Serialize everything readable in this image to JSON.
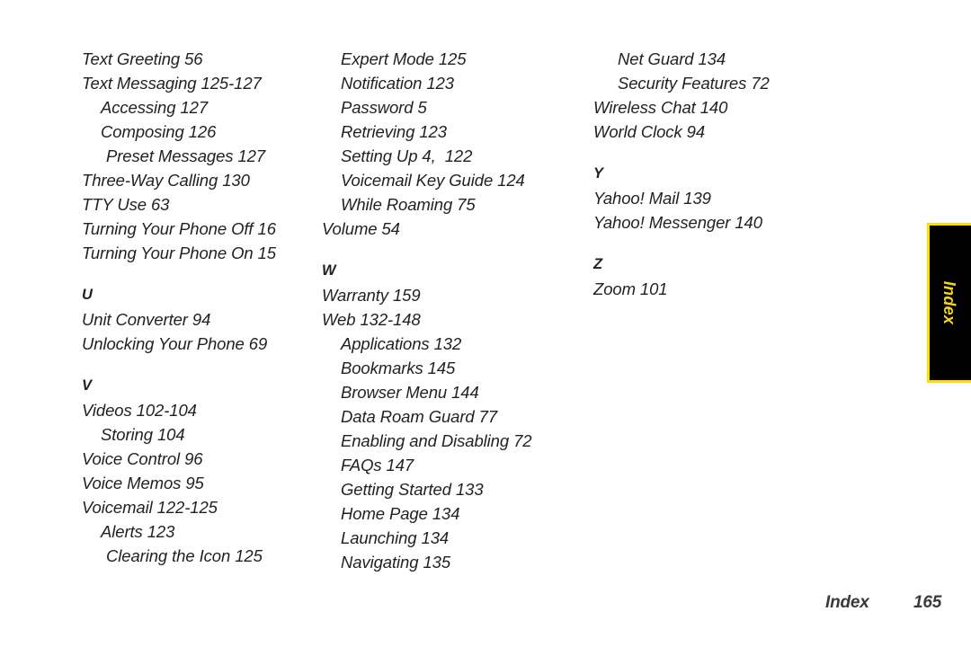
{
  "page": {
    "footer_label": "Index",
    "footer_page_number": "165",
    "thumb_tab_label": "Index",
    "colors": {
      "background": "#ffffff",
      "text": "#231f20",
      "tab_background": "#000000",
      "tab_border": "#ffdd00",
      "tab_text": "#f7d518",
      "footer_text": "#3a3a3c"
    }
  },
  "columns": [
    {
      "id": "column-1",
      "blocks": [
        {
          "type": "entries",
          "entries": [
            {
              "text": "Text Greeting 56",
              "level": 0
            },
            {
              "text": "Text Messaging 125-127",
              "level": 0
            },
            {
              "text": "Accessing 127",
              "level": 1
            },
            {
              "text": "Composing 126",
              "level": 1
            },
            {
              "text": "Preset Messages 127",
              "level": 2
            },
            {
              "text": "Three-Way Calling 130",
              "level": 0
            },
            {
              "text": "TTY Use 63",
              "level": 0
            },
            {
              "text": "Turning Your Phone Off 16",
              "level": 0
            },
            {
              "text": "Turning Your Phone On 15",
              "level": 0
            }
          ]
        },
        {
          "type": "section",
          "heading": "U",
          "entries": [
            {
              "text": "Unit Converter 94",
              "level": 0
            },
            {
              "text": "Unlocking Your Phone 69",
              "level": 0
            }
          ]
        },
        {
          "type": "section",
          "heading": "V",
          "entries": [
            {
              "text": "Videos 102-104",
              "level": 0
            },
            {
              "text": "Storing 104",
              "level": 1
            },
            {
              "text": "Voice Control 96",
              "level": 0
            },
            {
              "text": "Voice Memos 95",
              "level": 0
            },
            {
              "text": "Voicemail 122-125",
              "level": 0
            },
            {
              "text": "Alerts 123",
              "level": 1
            },
            {
              "text": "Clearing the Icon 125",
              "level": 2
            }
          ]
        }
      ]
    },
    {
      "id": "column-2",
      "blocks": [
        {
          "type": "entries",
          "entries": [
            {
              "text": "Expert Mode 125",
              "level": 1
            },
            {
              "text": "Notification 123",
              "level": 1
            },
            {
              "text": "Password 5",
              "level": 1
            },
            {
              "text": "Retrieving 123",
              "level": 1
            },
            {
              "text": "Setting Up 4,  122",
              "level": 1
            },
            {
              "text": "Voicemail Key Guide 124",
              "level": 1
            },
            {
              "text": "While Roaming 75",
              "level": 1
            },
            {
              "text": "Volume 54",
              "level": 0
            }
          ]
        },
        {
          "type": "section",
          "heading": "W",
          "entries": [
            {
              "text": "Warranty 159",
              "level": 0
            },
            {
              "text": "Web 132-148",
              "level": 0
            },
            {
              "text": "Applications 132",
              "level": 1
            },
            {
              "text": "Bookmarks 145",
              "level": 1
            },
            {
              "text": "Browser Menu 144",
              "level": 1
            },
            {
              "text": "Data Roam Guard 77",
              "level": 1
            },
            {
              "text": "Enabling and Disabling 72",
              "level": 1
            },
            {
              "text": "FAQs 147",
              "level": 1
            },
            {
              "text": "Getting Started 133",
              "level": 1
            },
            {
              "text": "Home Page 134",
              "level": 1
            },
            {
              "text": "Launching 134",
              "level": 1
            },
            {
              "text": "Navigating 135",
              "level": 1
            }
          ]
        }
      ]
    },
    {
      "id": "column-3",
      "blocks": [
        {
          "type": "entries",
          "entries": [
            {
              "text": "Net Guard 134",
              "level": 2
            },
            {
              "text": "Security Features 72",
              "level": 2
            },
            {
              "text": "Wireless Chat 140",
              "level": 0
            },
            {
              "text": "World Clock 94",
              "level": 0
            }
          ]
        },
        {
          "type": "section",
          "heading": "Y",
          "entries": [
            {
              "text": "Yahoo! Mail 139",
              "level": 0
            },
            {
              "text": "Yahoo! Messenger 140",
              "level": 0
            }
          ]
        },
        {
          "type": "section",
          "heading": "Z",
          "entries": [
            {
              "text": "Zoom 101",
              "level": 0
            }
          ]
        }
      ]
    }
  ]
}
